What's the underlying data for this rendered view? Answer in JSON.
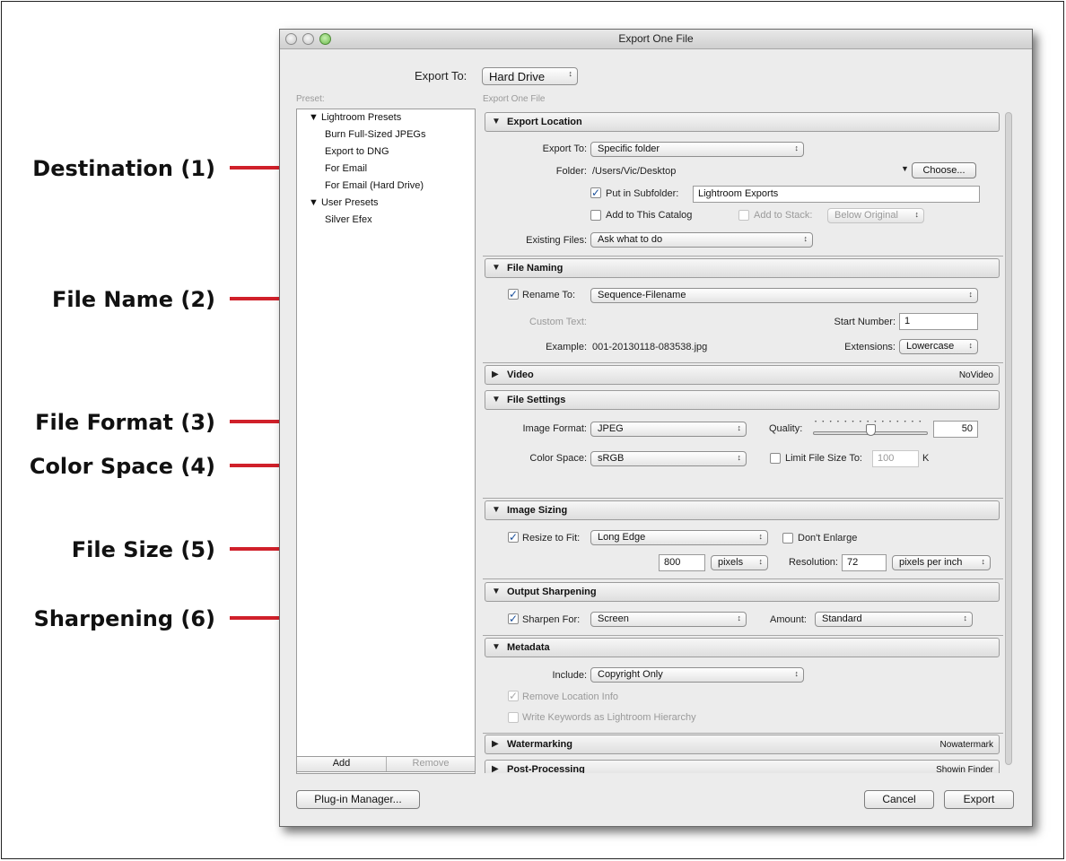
{
  "callouts": [
    {
      "label": "Destination (1)"
    },
    {
      "label": "File Name (2)"
    },
    {
      "label": "File Format (3)"
    },
    {
      "label": "Color Space (4)"
    },
    {
      "label": "File Size (5)"
    },
    {
      "label": "Sharpening (6)"
    }
  ],
  "window": {
    "title": "Export One File"
  },
  "top": {
    "export_to_label": "Export To:",
    "export_to_value": "Hard Drive"
  },
  "preset": {
    "heading": "Preset:",
    "items": [
      "Lightroom Presets",
      "Burn Full-Sized JPEGs",
      "Export to DNG",
      "For Email",
      "For Email (Hard Drive)",
      "User Presets",
      "Silver Efex"
    ],
    "add_label": "Add",
    "remove_label": "Remove"
  },
  "panel_heading": "Export One File",
  "export_location": {
    "title": "Export Location",
    "export_to_label": "Export To:",
    "export_to_value": "Specific folder",
    "folder_label": "Folder:",
    "folder_value": "/Users/Vic/Desktop",
    "choose_label": "Choose...",
    "subfolder_label": "Put in Subfolder:",
    "subfolder_value": "Lightroom Exports",
    "add_catalog_label": "Add to This Catalog",
    "add_stack_label": "Add to Stack:",
    "stack_value": "Below Original",
    "existing_label": "Existing Files:",
    "existing_value": "Ask what to do"
  },
  "file_naming": {
    "title": "File Naming",
    "rename_label": "Rename To:",
    "rename_value": "Sequence-Filename",
    "custom_text_label": "Custom Text:",
    "start_number_label": "Start Number:",
    "start_number_value": "1",
    "example_label": "Example:",
    "example_value": "001-20130118-083538.jpg",
    "extensions_label": "Extensions:",
    "extensions_value": "Lowercase"
  },
  "video": {
    "title": "Video",
    "status": "NoVideo"
  },
  "file_settings": {
    "title": "File Settings",
    "format_label": "Image Format:",
    "format_value": "JPEG",
    "quality_label": "Quality:",
    "quality_value": "50",
    "quality_fraction": 0.5,
    "colorspace_label": "Color Space:",
    "colorspace_value": "sRGB",
    "limit_label": "Limit File Size To:",
    "limit_value": "100",
    "limit_unit": "K"
  },
  "image_sizing": {
    "title": "Image Sizing",
    "resize_label": "Resize to Fit:",
    "resize_value": "Long Edge",
    "dont_enlarge_label": "Don't Enlarge",
    "size_value": "800",
    "size_unit": "pixels",
    "resolution_label": "Resolution:",
    "resolution_value": "72",
    "resolution_unit": "pixels per inch"
  },
  "output_sharpening": {
    "title": "Output Sharpening",
    "sharpen_label": "Sharpen For:",
    "sharpen_value": "Screen",
    "amount_label": "Amount:",
    "amount_value": "Standard"
  },
  "metadata": {
    "title": "Metadata",
    "include_label": "Include:",
    "include_value": "Copyright Only",
    "remove_location_label": "Remove Location Info",
    "keywords_label": "Write Keywords as Lightroom Hierarchy"
  },
  "watermarking": {
    "title": "Watermarking",
    "status": "Nowatermark"
  },
  "post_processing": {
    "title": "Post-Processing",
    "status": "Showin Finder"
  },
  "buttons": {
    "plugin_manager": "Plug-in Manager...",
    "cancel": "Cancel",
    "export": "Export"
  },
  "colors": {
    "arrow": "#d0202a",
    "window_bg": "#ececec"
  }
}
